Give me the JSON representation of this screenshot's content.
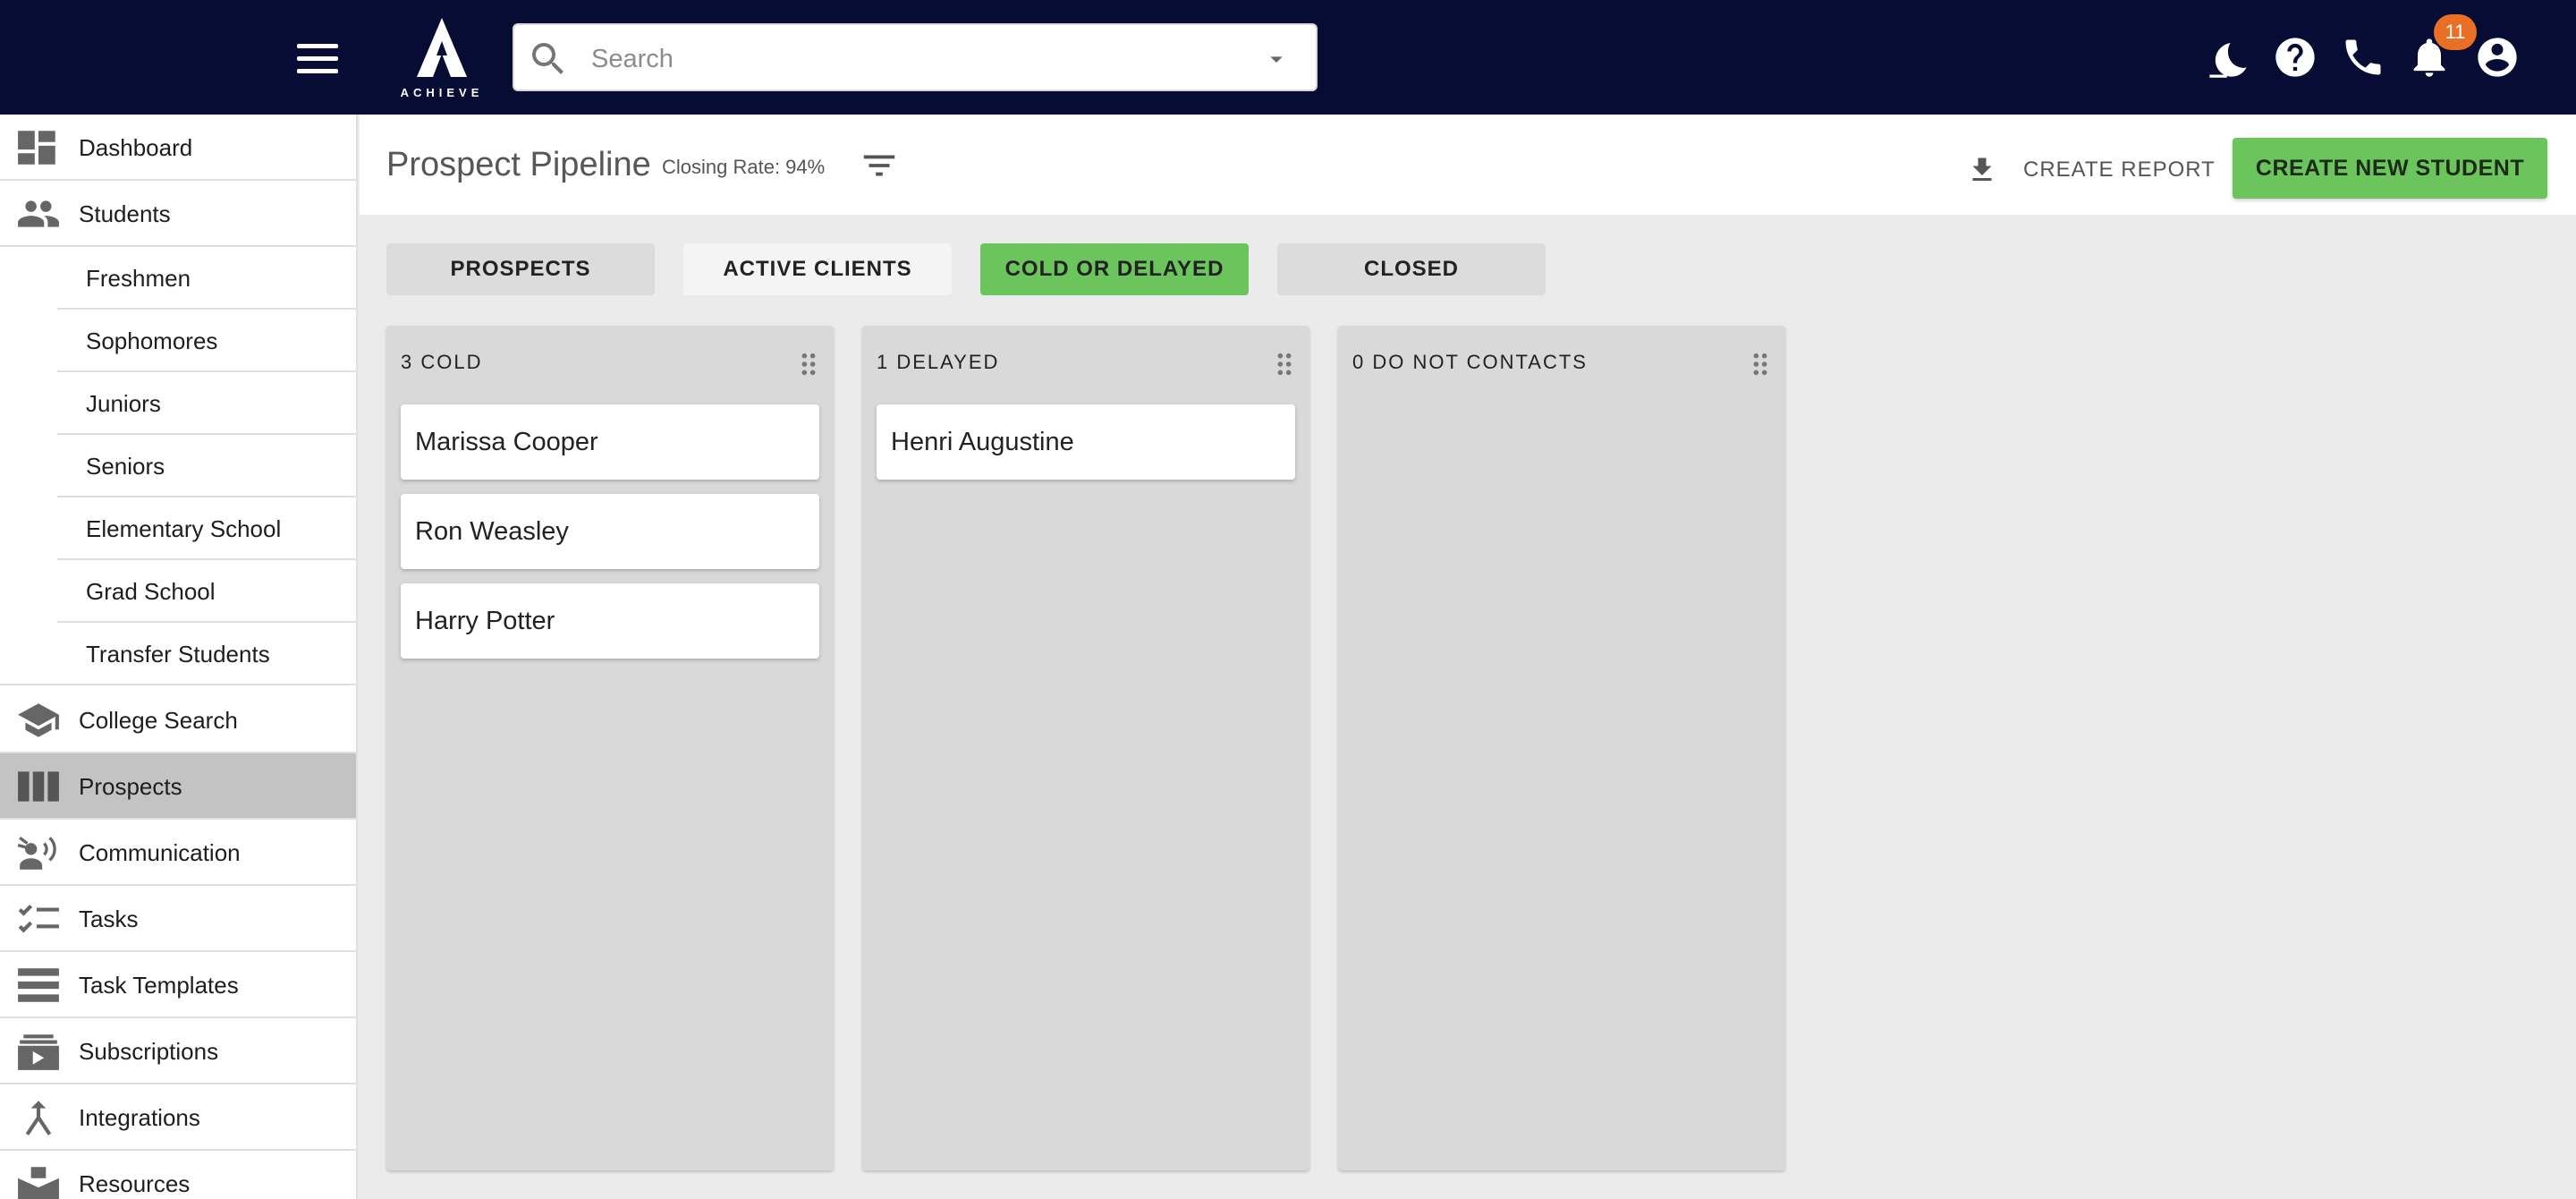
{
  "app": {
    "logo_text": "ACHIEVE"
  },
  "search": {
    "placeholder": "Search",
    "value": ""
  },
  "notifications": {
    "count": "11"
  },
  "topbar_icons": [
    "dark-mode-icon",
    "help-icon",
    "phone-icon",
    "bell-icon",
    "account-icon"
  ],
  "sidebar": {
    "dashboard": "Dashboard",
    "students": "Students",
    "student_groups": [
      "Freshmen",
      "Sophomores",
      "Juniors",
      "Seniors",
      "Elementary School",
      "Grad School",
      "Transfer Students"
    ],
    "college_search": "College Search",
    "prospects": "Prospects",
    "communication": "Communication",
    "tasks": "Tasks",
    "task_templates": "Task Templates",
    "subscriptions": "Subscriptions",
    "integrations": "Integrations",
    "resources": "Resources",
    "active_item": "Prospects"
  },
  "header": {
    "title": "Prospect Pipeline",
    "closing_rate": "Closing Rate: 94%",
    "create_report": "CREATE REPORT",
    "create_student": "CREATE NEW STUDENT"
  },
  "tabs": {
    "items": [
      "PROSPECTS",
      "ACTIVE CLIENTS",
      "COLD OR DELAYED",
      "CLOSED"
    ],
    "selected": "COLD OR DELAYED"
  },
  "columns": [
    {
      "title": "3 COLD",
      "cards": [
        "Marissa Cooper",
        "Ron Weasley",
        "Harry Potter"
      ]
    },
    {
      "title": "1 DELAYED",
      "cards": [
        "Henri Augustine"
      ]
    },
    {
      "title": "0 DO NOT CONTACTS",
      "cards": []
    }
  ],
  "colors": {
    "topbar": "#070c35",
    "accent_green": "#6cc45c",
    "badge": "#e86f25",
    "active_nav": "#c3c3c3",
    "column_bg": "#d9d9d9"
  }
}
